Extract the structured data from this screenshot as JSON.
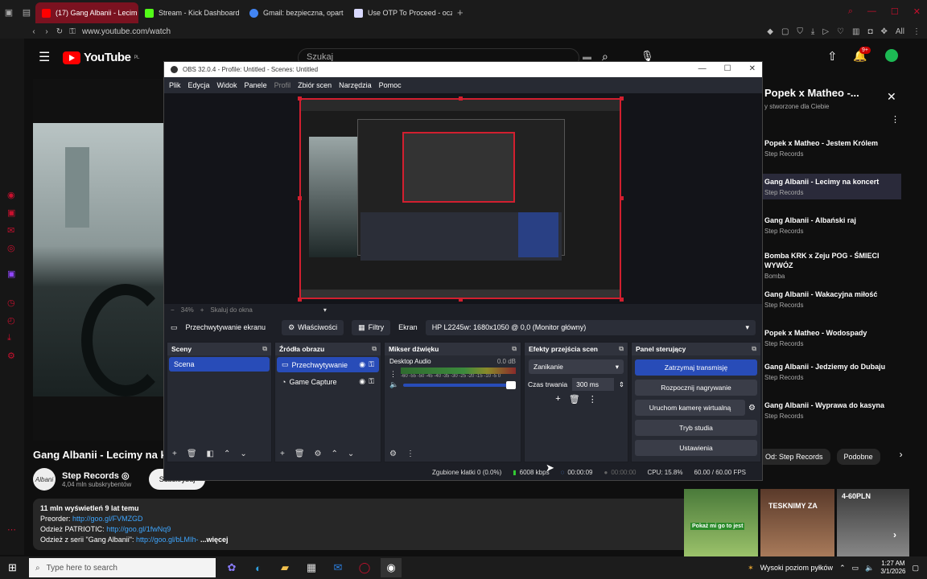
{
  "browser": {
    "tabs": [
      {
        "label": "(17) Gang Albanii - Lecim",
        "color": "#ff0000",
        "active": true
      },
      {
        "label": "Stream - Kick Dashboard",
        "color": "#53fc18",
        "active": false
      },
      {
        "label": "Gmail: bezpieczna, opart",
        "color": "#4285f4",
        "active": false
      },
      {
        "label": "Use OTP To Proceed - ocz",
        "color": "#d9d9ff",
        "active": false
      }
    ],
    "new_tab_label": "+",
    "url": "www.youtube.com/watch",
    "ext_last": "All",
    "sidebar_icons": [
      "music-icon",
      "shopping-icon",
      "messenger-icon",
      "instagram-icon",
      "twitch-icon",
      "history-icon",
      "clock-icon",
      "download-icon",
      "settings-icon"
    ]
  },
  "youtube": {
    "logo_text": "YouTube",
    "logo_sup": "PL",
    "search_placeholder": "Szukaj",
    "notif_count": "9+",
    "video_title": "Gang Albanii - Lecimy na k",
    "channel": {
      "name": "Step Records ◎",
      "subs": "4,04 mln subskrybentów",
      "avatar_text": "Albani"
    },
    "subscribe_label": "Subskrybuj",
    "description": {
      "stats": "11 mln wyświetleń  9 lat temu",
      "line1_label": "Preorder: ",
      "line1_link": "http://goo.gl/FVMZGD",
      "line2_label": "Odzież PATRIOTIC: ",
      "line2_link": "http://goo.gl/1fwNq9",
      "line3_label": "Odzież z serii \"Gang Albanii\": ",
      "line3_link": "http://goo.gl/bLMIh-",
      "more": " ...więcej"
    },
    "playlist": {
      "title": "Popek x Matheo -...",
      "subtitle": "y stworzone dla Ciebie",
      "items": [
        {
          "title": "Popek x Matheo - Jestem Królem",
          "channel": "Step Records",
          "active": false
        },
        {
          "title": "Gang Albanii - Lecimy na koncert",
          "channel": "Step Records",
          "active": true
        },
        {
          "title": "Gang Albanii - Albański raj",
          "channel": "Step Records",
          "active": false
        },
        {
          "title": "Bomba KRK x Zeju POG - ŚMIECI WYWÓZ",
          "channel": "Bomba",
          "active": false
        },
        {
          "title": "Gang Albanii - Wakacyjna miłość",
          "channel": "Step Records",
          "active": false
        },
        {
          "title": "Popek x Matheo - Wodospady",
          "channel": "Step Records",
          "active": false
        },
        {
          "title": "Gang Albanii - Jedziemy do Dubaju",
          "channel": "Step Records",
          "active": false
        },
        {
          "title": "Gang Albanii - Wyprawa do kasyna",
          "channel": "Step Records",
          "active": false
        }
      ]
    },
    "chips": [
      "Od: Step Records",
      "Podobne"
    ],
    "shorts": [
      "Pokaż mi go to jest",
      "TESKNIMY ZA",
      "4-60PLN"
    ]
  },
  "obs": {
    "title": "OBS 32.0.4 - Profile: Untitled - Scenes: Untitled",
    "menu": [
      "Plik",
      "Edycja",
      "Widok",
      "Panele",
      "Profil",
      "Zbiór scen",
      "Narzędzia",
      "Pomoc"
    ],
    "zoom": "34%",
    "zoom_fit": "Skaluj do okna",
    "source_bar": {
      "active_source": "Przechwytywanie ekranu",
      "properties": "Właściwości",
      "filters": "Filtry",
      "display_label": "Ekran",
      "display_value": "HP L2245w: 1680x1050 @ 0,0 (Monitor główny)"
    },
    "docks": {
      "scenes": {
        "title": "Sceny",
        "items": [
          "Scena"
        ]
      },
      "sources": {
        "title": "Źródła obrazu",
        "items": [
          "Przechwytywanie",
          "Game Capture"
        ]
      },
      "mixer": {
        "title": "Mikser dźwięku",
        "channel": "Desktop Audio",
        "level": "0.0 dB",
        "ticks": "-60 -55 -50 -45 -40 -35 -30 -25 -20 -15 -10 -5 0"
      },
      "transitions": {
        "title": "Efekty przejścia scen",
        "selected": "Zanikanie",
        "duration_label": "Czas trwania",
        "duration_value": "300 ms"
      },
      "controls": {
        "title": "Panel sterujący",
        "buttons": [
          "Zatrzymaj transmisję",
          "Rozpocznij nagrywanie",
          "Uruchom kamerę wirtualną",
          "Tryb studia",
          "Ustawienia"
        ]
      }
    },
    "status": {
      "dropped": "Zgubione klatki 0 (0.0%)",
      "bitrate": "6008 kbps",
      "stream_time": "00:00:09",
      "rec_time": "00:00:00",
      "cpu": "CPU: 15.8%",
      "fps": "60.00 / 60.00 FPS"
    },
    "colors": {
      "accent": "#284cb8",
      "preview_border": "#d21f2f"
    }
  },
  "taskbar": {
    "search_placeholder": "Type here to search",
    "weather": "Wysoki poziom pyłków",
    "time": "1:27 AM",
    "date": "3/1/2026"
  }
}
